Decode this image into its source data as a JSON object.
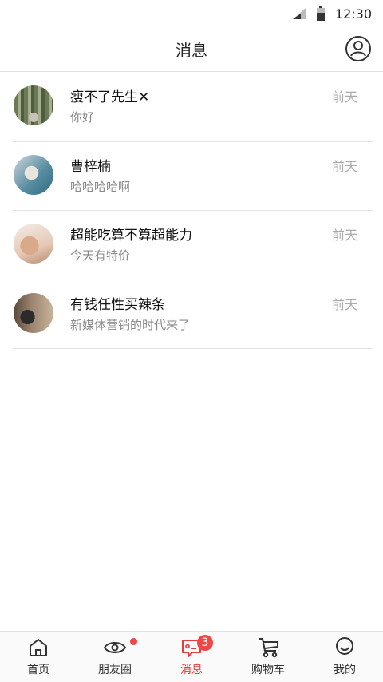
{
  "status_bar": {
    "time": "12:30"
  },
  "header": {
    "title": "消息"
  },
  "chats": [
    {
      "name": "瘦不了先生✕",
      "preview": "你好",
      "time": "前天"
    },
    {
      "name": "曹梓楠",
      "preview": "哈哈哈哈啊",
      "time": "前天"
    },
    {
      "name": "超能吃算不算超能力",
      "preview": "今天有特价",
      "time": "前天"
    },
    {
      "name": "有钱任性买辣条",
      "preview": "新媒体营销的时代来了",
      "time": "前天"
    }
  ],
  "tabs": [
    {
      "label": "首页",
      "icon": "home-icon"
    },
    {
      "label": "朋友圈",
      "icon": "eye-icon"
    },
    {
      "label": "消息",
      "icon": "message-icon",
      "badge": "3"
    },
    {
      "label": "购物车",
      "icon": "cart-icon"
    },
    {
      "label": "我的",
      "icon": "smile-icon"
    }
  ],
  "colors": {
    "accent": "#e83a3a",
    "badge": "#f04646",
    "muted": "#888888"
  }
}
